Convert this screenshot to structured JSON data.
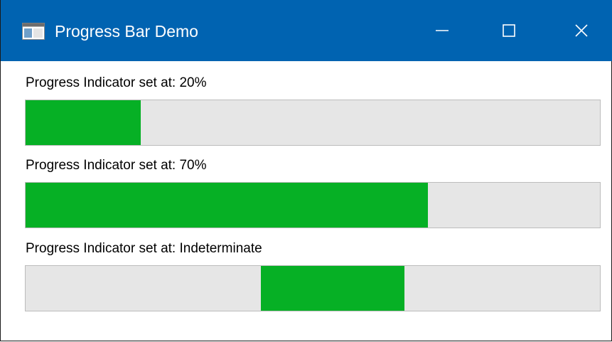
{
  "window": {
    "title": "Progress Bar Demo",
    "titlebar_color": "#0063b1",
    "icons": {
      "app": "app-window-icon",
      "minimize": "minimize-icon",
      "maximize": "maximize-icon",
      "close": "close-icon"
    }
  },
  "progress": [
    {
      "label": "Progress Indicator set at: 20%",
      "value": 0.2,
      "indeterminate": false
    },
    {
      "label": "Progress Indicator set at: 70%",
      "value": 0.7,
      "indeterminate": false
    },
    {
      "label": "Progress Indicator set at: Indeterminate",
      "value": null,
      "indeterminate": true
    }
  ],
  "colors": {
    "fill": "#06b025",
    "track": "#e6e6e6",
    "track_border": "#bcbcbc"
  }
}
